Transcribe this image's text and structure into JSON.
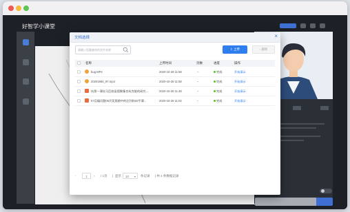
{
  "app": {
    "title": "好智学小课堂"
  },
  "colors": {
    "accent": "#2f7ef0",
    "success": "#52c41a",
    "app_bg": "#1d2127"
  },
  "dialog": {
    "title": "文档选择",
    "close_icon": "close-icon",
    "search": {
      "placeholder": "请输入您要查找的文件名称",
      "value": ""
    },
    "upload_label": "上传",
    "delete_label": "删除",
    "columns": [
      "名称",
      "上传时间",
      "页数",
      "进度",
      "操作"
    ],
    "rows": [
      {
        "name": "bug.MP4",
        "time": "2020-10-28 11:58",
        "pages": "–",
        "status": "完成",
        "action": "开始演示",
        "icon": "video-file-icon",
        "color": "#f0a236"
      },
      {
        "name": "20201860_97.mp4",
        "time": "2020-10-28 11:58",
        "pages": "–",
        "status": "完成",
        "action": "开始演示",
        "icon": "video-file-icon",
        "color": "#f0a236"
      },
      {
        "name": "杭第一课化习后收梁图聚集合杭克能的研究...",
        "time": "2020-10-28 11:48",
        "pages": "–",
        "status": "完成",
        "action": "开始演示",
        "icon": "ppt-file-icon",
        "color": "#ef6a3a"
      },
      {
        "name": "07月编问题06开奖周期中的比列和20平课...",
        "time": "2020-10-28 11:02",
        "pages": "–",
        "status": "完成",
        "action": "开始演示",
        "icon": "ppt-file-icon",
        "color": "#ef6a3a"
      }
    ],
    "pager": {
      "current": "1",
      "total_pages": "/ 1页",
      "show_label": "显示",
      "page_size": "10",
      "per_label": "条记录",
      "summary": "| 共 4 条数据记录"
    }
  }
}
